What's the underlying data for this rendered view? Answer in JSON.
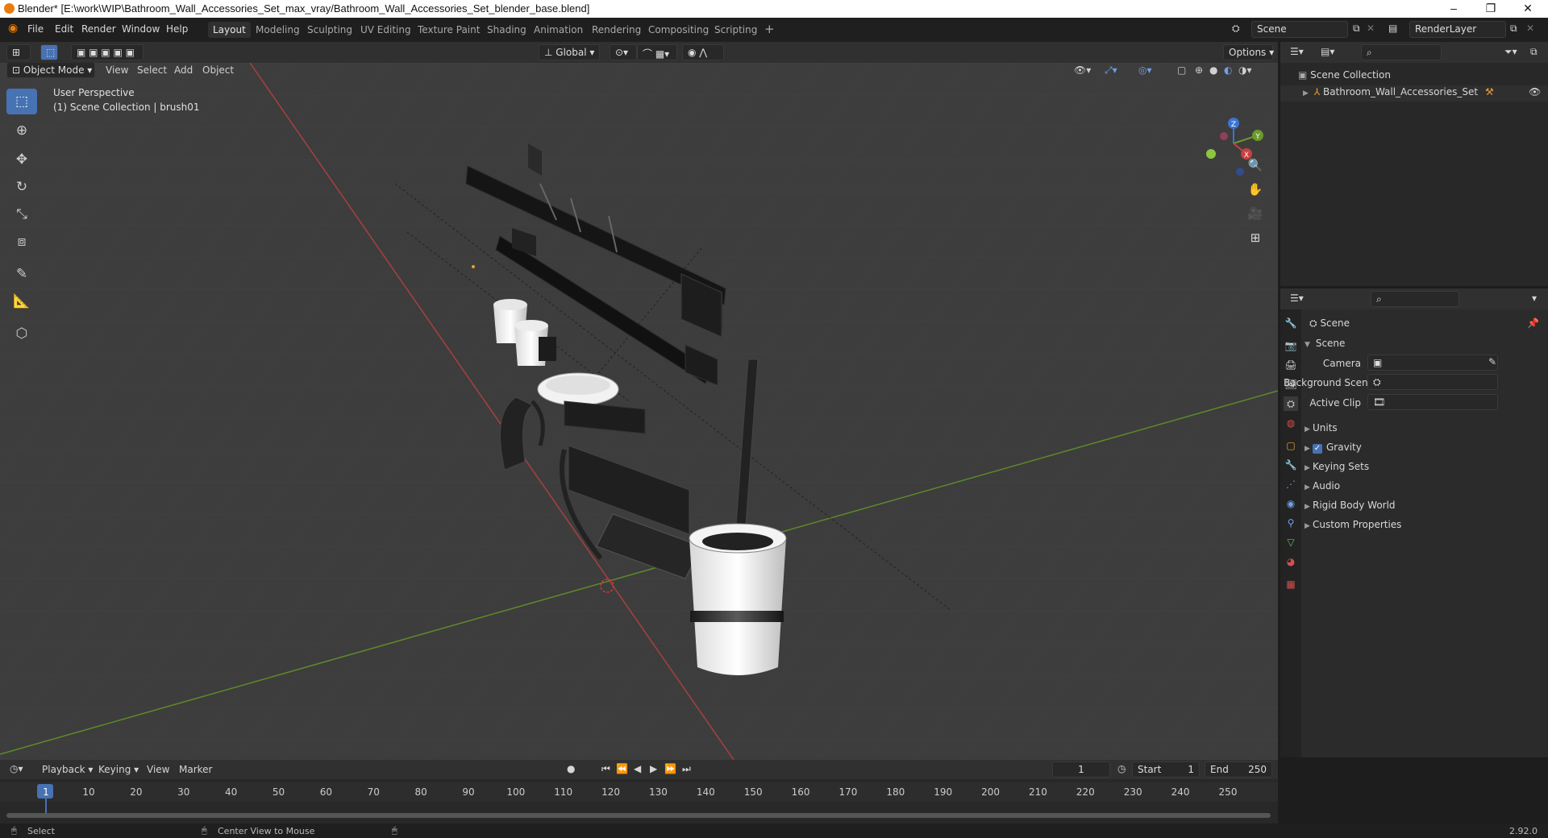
{
  "window": {
    "title": "Blender* [E:\\work\\WIP\\Bathroom_Wall_Accessories_Set_max_vray/Bathroom_Wall_Accessories_Set_blender_base.blend]",
    "minimize": "–",
    "maximize": "❐",
    "close": "✕"
  },
  "menu": {
    "items": [
      "File",
      "Edit",
      "Render",
      "Window",
      "Help"
    ]
  },
  "workspaces": [
    "Layout",
    "Modeling",
    "Sculpting",
    "UV Editing",
    "Texture Paint",
    "Shading",
    "Animation",
    "Rendering",
    "Compositing",
    "Scripting",
    "+"
  ],
  "active_workspace": "Layout",
  "scene_field": "Scene",
  "renderlayer_field": "RenderLayer",
  "viewport": {
    "mode": "Object Mode",
    "menus": [
      "View",
      "Select",
      "Add",
      "Object"
    ],
    "orientation": "Global",
    "options": "Options",
    "perspective_label": "User Perspective",
    "collection_label": "(1) Scene Collection | brush01",
    "gizmo_axes": {
      "z": "Z",
      "y": "Y",
      "x": "X"
    }
  },
  "outliner": {
    "root": "Scene Collection",
    "items": [
      "Bathroom_Wall_Accessories_Set"
    ]
  },
  "properties": {
    "header": "Scene",
    "panel": "Scene",
    "fields": [
      {
        "label": "Camera",
        "value": ""
      },
      {
        "label": "Background Scene",
        "value": ""
      },
      {
        "label": "Active Clip",
        "value": ""
      }
    ],
    "subpanels": [
      "Units",
      "Gravity",
      "Keying Sets",
      "Audio",
      "Rigid Body World",
      "Custom Properties"
    ],
    "gravity_checked": true
  },
  "timeline": {
    "menus": [
      "Playback",
      "Keying",
      "View",
      "Marker"
    ],
    "current_frame": "1",
    "start_label": "Start",
    "start": "1",
    "end_label": "End",
    "end": "250",
    "ruler": [
      "1",
      "10",
      "20",
      "30",
      "40",
      "50",
      "60",
      "70",
      "80",
      "90",
      "100",
      "110",
      "120",
      "130",
      "140",
      "150",
      "160",
      "170",
      "180",
      "190",
      "200",
      "210",
      "220",
      "230",
      "240",
      "250"
    ]
  },
  "status": {
    "left": "Select",
    "middle": "Center View to Mouse",
    "version": "2.92.0"
  },
  "colors": {
    "accent": "#4772b3",
    "x_axis": "#c9413f",
    "y_axis": "#6a9a2a",
    "z_axis": "#3c74d3"
  }
}
